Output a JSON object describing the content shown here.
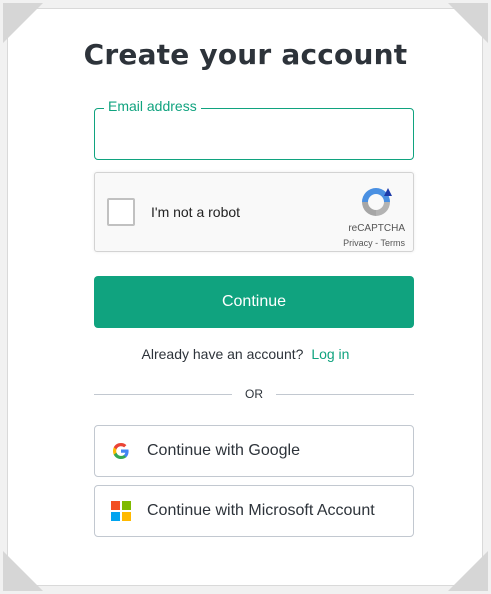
{
  "title": "Create your account",
  "email": {
    "label": "Email address",
    "value": ""
  },
  "captcha": {
    "label": "I'm not a robot",
    "brand": "reCAPTCHA",
    "privacy": "Privacy",
    "separator": " - ",
    "terms": "Terms"
  },
  "continue_label": "Continue",
  "login": {
    "prompt": "Already have an account?",
    "link": "Log in"
  },
  "divider_text": "OR",
  "social": {
    "google": {
      "label": "Continue with Google",
      "icon": "google-icon"
    },
    "microsoft": {
      "label": "Continue with Microsoft Account",
      "icon": "microsoft-icon"
    }
  },
  "colors": {
    "accent": "#10a37f",
    "text": "#2d333a",
    "border": "#c2c8d0"
  }
}
